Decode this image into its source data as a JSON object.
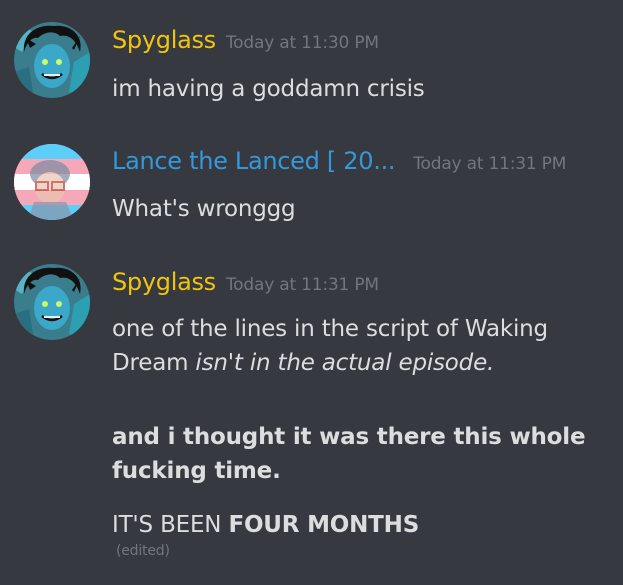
{
  "colors": {
    "background": "#36393f",
    "spyglass_name": "#f1c40f",
    "lance_name": "#3498db",
    "message_text": "#dcddde",
    "muted": "#72767d"
  },
  "messages": [
    {
      "author": "Spyglass",
      "avatar_icon": "spyglass-avatar-icon",
      "timestamp": "Today at 11:30 PM",
      "lines": [
        "im having a goddamn crisis"
      ]
    },
    {
      "author": "Lance the Lanced [ 20...",
      "avatar_icon": "lance-avatar-icon",
      "timestamp": "Today at 11:31 PM",
      "lines": [
        "What's wronggg"
      ]
    },
    {
      "author": "Spyglass",
      "avatar_icon": "spyglass-avatar-icon",
      "timestamp": "Today at 11:31 PM",
      "line1": "one of the lines in the script of Waking",
      "line2_plain": "Dream ",
      "line2_italic": "isn't in the actual episode.",
      "bold_line1": "and i thought it was there this whole",
      "bold_line2": "fucking time.",
      "last_plain": "IT'S BEEN ",
      "last_bold": "FOUR MONTHS",
      "edited_label": "(edited)"
    }
  ]
}
